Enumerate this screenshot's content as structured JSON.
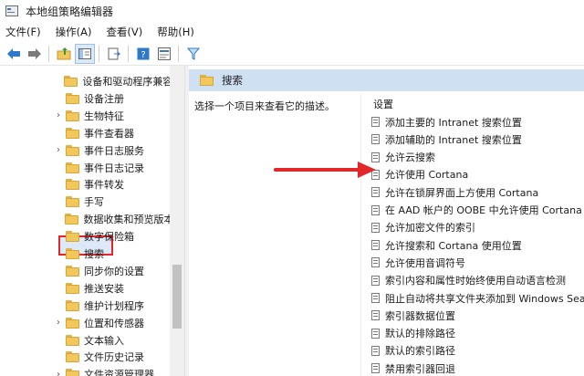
{
  "window": {
    "title": "本地组策略编辑器"
  },
  "menu": [
    "文件(F)",
    "操作(A)",
    "查看(V)",
    "帮助(H)"
  ],
  "toolbar": {
    "buttons": [
      "back-arrow-icon",
      "forward-arrow-icon",
      "folder-up-icon",
      "show-hide-tree-icon",
      "export-list-icon",
      "help-icon",
      "properties-icon",
      "filter-icon"
    ]
  },
  "tree": {
    "items": [
      {
        "label": "设备和驱动程序兼容性",
        "expandable": false
      },
      {
        "label": "设备注册",
        "expandable": false
      },
      {
        "label": "生物特征",
        "expandable": true
      },
      {
        "label": "事件查看器",
        "expandable": false
      },
      {
        "label": "事件日志服务",
        "expandable": true
      },
      {
        "label": "事件日志记录",
        "expandable": false
      },
      {
        "label": "事件转发",
        "expandable": false
      },
      {
        "label": "手写",
        "expandable": false
      },
      {
        "label": "数据收集和预览版本",
        "expandable": false
      },
      {
        "label": "数字保险箱",
        "expandable": false
      },
      {
        "label": "搜索",
        "expandable": false,
        "selected": true
      },
      {
        "label": "同步你的设置",
        "expandable": false
      },
      {
        "label": "推送安装",
        "expandable": false
      },
      {
        "label": "维护计划程序",
        "expandable": false
      },
      {
        "label": "位置和传感器",
        "expandable": true
      },
      {
        "label": "文本输入",
        "expandable": false
      },
      {
        "label": "文件历史记录",
        "expandable": false
      },
      {
        "label": "文件资源管理器",
        "expandable": true
      }
    ]
  },
  "detail": {
    "header": "搜索",
    "description": "选择一个项目来查看它的描述。",
    "column_header": "设置",
    "settings": [
      "添加主要的 Intranet 搜索位置",
      "添加辅助的 Intranet 搜索位置",
      "允许云搜索",
      "允许使用 Cortana",
      "允许在锁屏界面上方使用 Cortana",
      "在 AAD 帐户的 OOBE 中允许使用 Cortana",
      "允许加密文件的索引",
      "允许搜索和 Cortana 使用位置",
      "允许使用音调符号",
      "索引内容和属性时始终使用自动语言检测",
      "阻止自动将共享文件夹添加到 Windows Sea",
      "索引器数据位置",
      "默认的排除路径",
      "默认的索引路径",
      "禁用索引器回退"
    ]
  },
  "colors": {
    "highlight_box": "#e3262a",
    "arrow": "#e3262a",
    "header_bg": "#cfe0f3"
  }
}
